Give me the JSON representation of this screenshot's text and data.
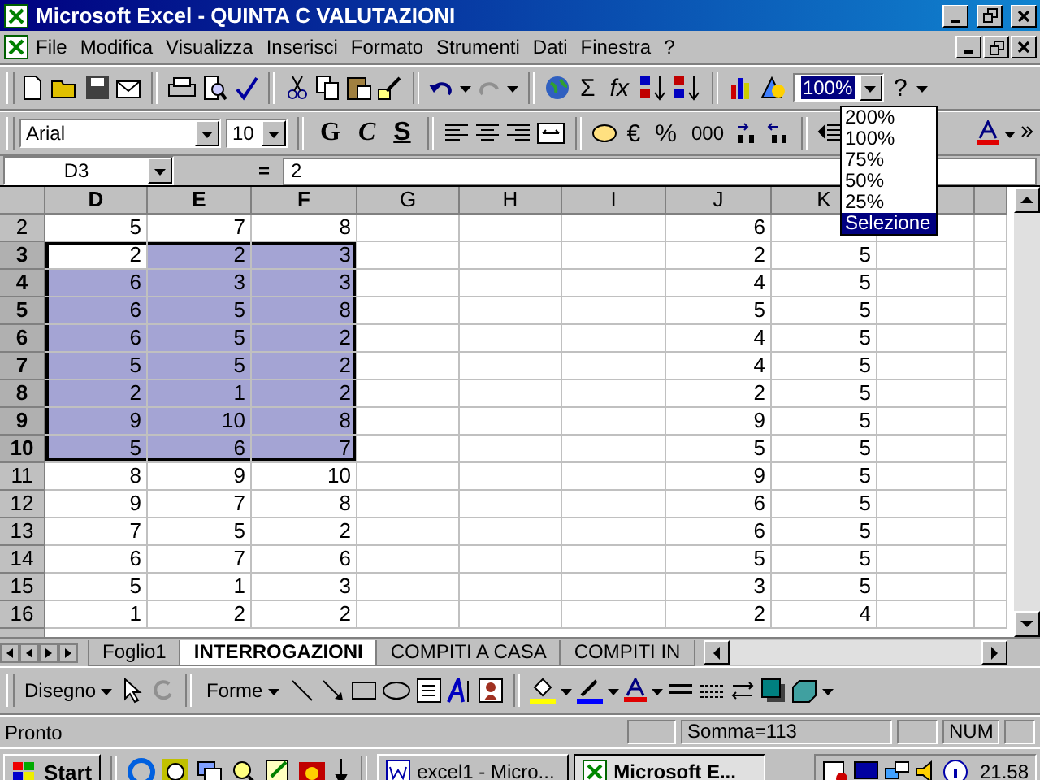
{
  "window": {
    "title": "Microsoft Excel - QUINTA C VALUTAZIONI"
  },
  "menu": [
    "File",
    "Modifica",
    "Visualizza",
    "Inserisci",
    "Formato",
    "Strumenti",
    "Dati",
    "Finestra",
    "?"
  ],
  "standard_toolbar": {
    "sum_symbol": "Σ",
    "function_symbol": "fx",
    "zoom": "100%",
    "help_symbol": "?"
  },
  "zoom_menu": [
    {
      "label": "200%",
      "selected": false
    },
    {
      "label": "100%",
      "selected": false
    },
    {
      "label": "75%",
      "selected": false
    },
    {
      "label": "50%",
      "selected": false
    },
    {
      "label": "25%",
      "selected": false
    },
    {
      "label": "Selezione",
      "selected": true
    }
  ],
  "formatting_toolbar": {
    "font": "Arial",
    "size": "10",
    "bold": "G",
    "italic": "C",
    "underline": "S",
    "euro": "€",
    "percent": "%",
    "thousands": "000"
  },
  "formula_bar": {
    "name_box": "D3",
    "equals": "=",
    "value": "2"
  },
  "columns": [
    {
      "label": "D",
      "selected": true
    },
    {
      "label": "E",
      "selected": true
    },
    {
      "label": "F",
      "selected": true
    },
    {
      "label": "G",
      "selected": false
    },
    {
      "label": "H",
      "selected": false
    },
    {
      "label": "I",
      "selected": false
    },
    {
      "label": "J",
      "selected": false
    },
    {
      "label": "K",
      "selected": false
    }
  ],
  "rows": [
    {
      "label": "2",
      "selected": false,
      "cells": [
        "5",
        "7",
        "8",
        "",
        "",
        "",
        "6",
        ""
      ]
    },
    {
      "label": "3",
      "selected": true,
      "cells": [
        "2",
        "2",
        "3",
        "",
        "",
        "",
        "2",
        "5"
      ]
    },
    {
      "label": "4",
      "selected": true,
      "cells": [
        "6",
        "3",
        "3",
        "",
        "",
        "",
        "4",
        "5"
      ]
    },
    {
      "label": "5",
      "selected": true,
      "cells": [
        "6",
        "5",
        "8",
        "",
        "",
        "",
        "5",
        "5"
      ]
    },
    {
      "label": "6",
      "selected": true,
      "cells": [
        "6",
        "5",
        "2",
        "",
        "",
        "",
        "4",
        "5"
      ]
    },
    {
      "label": "7",
      "selected": true,
      "cells": [
        "5",
        "5",
        "2",
        "",
        "",
        "",
        "4",
        "5"
      ]
    },
    {
      "label": "8",
      "selected": true,
      "cells": [
        "2",
        "1",
        "2",
        "",
        "",
        "",
        "2",
        "5"
      ]
    },
    {
      "label": "9",
      "selected": true,
      "cells": [
        "9",
        "10",
        "8",
        "",
        "",
        "",
        "9",
        "5"
      ]
    },
    {
      "label": "10",
      "selected": true,
      "cells": [
        "5",
        "6",
        "7",
        "",
        "",
        "",
        "5",
        "5"
      ]
    },
    {
      "label": "11",
      "selected": false,
      "cells": [
        "8",
        "9",
        "10",
        "",
        "",
        "",
        "9",
        "5"
      ]
    },
    {
      "label": "12",
      "selected": false,
      "cells": [
        "9",
        "7",
        "8",
        "",
        "",
        "",
        "6",
        "5"
      ]
    },
    {
      "label": "13",
      "selected": false,
      "cells": [
        "7",
        "5",
        "2",
        "",
        "",
        "",
        "6",
        "5"
      ]
    },
    {
      "label": "14",
      "selected": false,
      "cells": [
        "6",
        "7",
        "6",
        "",
        "",
        "",
        "5",
        "5"
      ]
    },
    {
      "label": "15",
      "selected": false,
      "cells": [
        "5",
        "1",
        "3",
        "",
        "",
        "",
        "3",
        "5"
      ]
    },
    {
      "label": "16",
      "selected": false,
      "cells": [
        "1",
        "2",
        "2",
        "",
        "",
        "",
        "2",
        "4"
      ]
    }
  ],
  "sheet_tabs": [
    {
      "label": "Foglio1",
      "selected": false
    },
    {
      "label": "INTERROGAZIONI",
      "selected": true
    },
    {
      "label": "COMPITI A CASA",
      "selected": false
    },
    {
      "label": "COMPITI IN",
      "selected": false
    }
  ],
  "drawing_toolbar": {
    "draw": "Disegno",
    "shapes": "Forme"
  },
  "status_bar": {
    "status": "Pronto",
    "sum": "Somma=113",
    "num": "NUM"
  },
  "taskbar": {
    "start": "Start",
    "tasks": [
      {
        "label": "excel1 - Micro...",
        "selected": false
      },
      {
        "label": "Microsoft E...",
        "selected": true
      }
    ],
    "clock": "21.58"
  }
}
